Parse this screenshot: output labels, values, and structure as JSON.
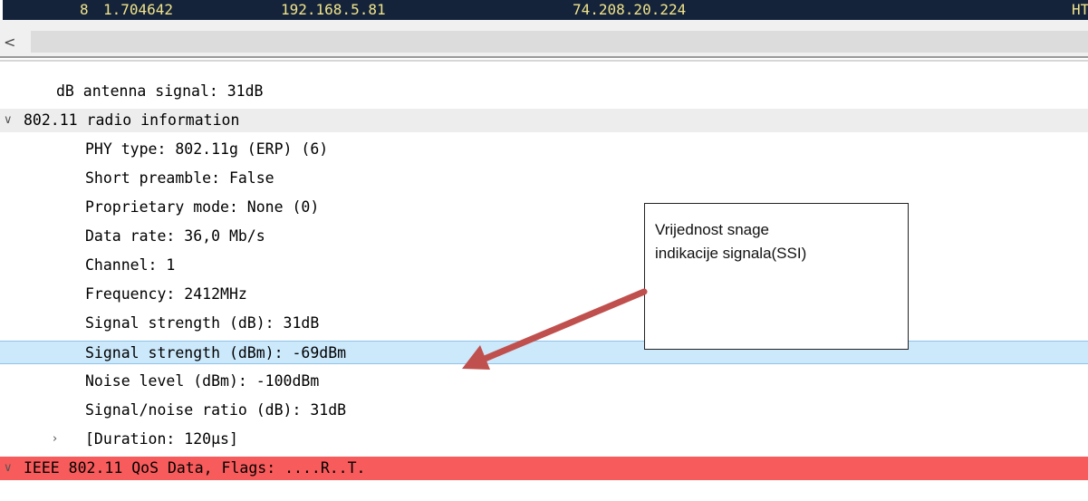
{
  "packet_list": {
    "row": {
      "number": "8",
      "time": "1.704642",
      "source": "192.168.5.81",
      "destination": "74.208.20.224",
      "protocol": "HT"
    }
  },
  "scrollbar": {
    "left_arrow": "<"
  },
  "tree": {
    "antenna_signal": "dB antenna signal: 31dB",
    "radio_info": {
      "label": "802.11 radio information",
      "phy_type": "PHY type: 802.11g (ERP) (6)",
      "short_preamble": "Short preamble: False",
      "proprietary_mode": "Proprietary mode: None (0)",
      "data_rate": "Data rate: 36,0 Mb/s",
      "channel": "Channel: 1",
      "frequency": "Frequency: 2412MHz",
      "signal_db": "Signal strength (dB): 31dB",
      "signal_dbm": "Signal strength (dBm): -69dBm",
      "noise": "Noise level (dBm): -100dBm",
      "snr": "Signal/noise ratio (dB): 31dB",
      "duration": "[Duration: 120µs]"
    },
    "qos_data": "IEEE 802.11 QoS Data, Flags: ....R..T."
  },
  "callout": {
    "line1": "Vrijednost snage",
    "line2": "indikacije signala(SSI)"
  },
  "colors": {
    "highlight": "#cce8fb",
    "error_row": "#f75b5b",
    "arrow": "#c0504d",
    "packet_row_bg": "#14233a",
    "packet_row_text": "#f0e38a"
  }
}
